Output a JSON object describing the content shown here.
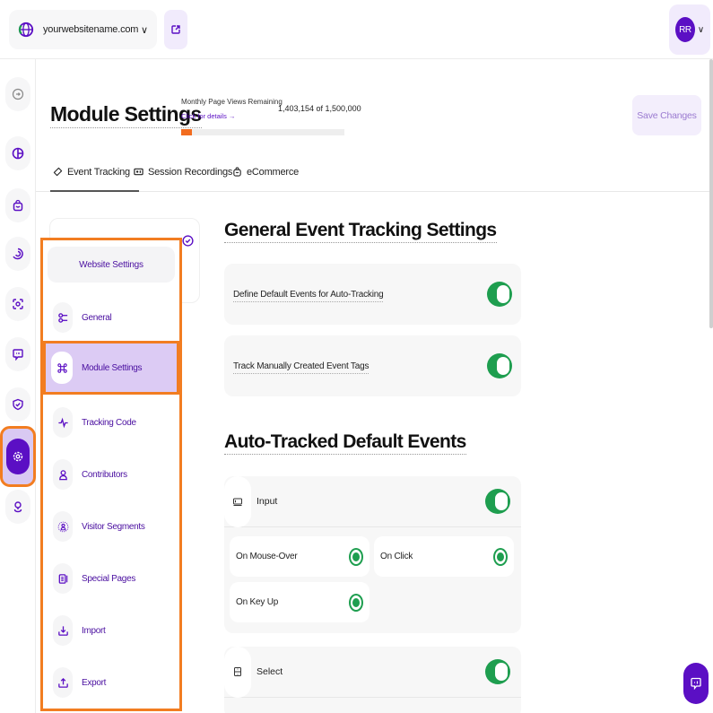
{
  "topbar": {
    "site_name": "yourwebsitename.com",
    "site_icon": "globe-icon",
    "external_link_icon": "external-link-icon",
    "user_initials": "RR"
  },
  "rail": {
    "items": [
      {
        "name": "collapse",
        "icon": "arrow-right-circle-icon"
      },
      {
        "name": "analytics",
        "icon": "pie-chart-icon"
      },
      {
        "name": "ecommerce",
        "icon": "shopping-bag-icon"
      },
      {
        "name": "heatmaps",
        "icon": "target-icon"
      },
      {
        "name": "recordings",
        "icon": "scan-icon"
      },
      {
        "name": "feedback",
        "icon": "chat-icon"
      },
      {
        "name": "privacy",
        "icon": "shield-check-icon"
      },
      {
        "name": "settings",
        "icon": "gear-icon",
        "active": true
      },
      {
        "name": "locations",
        "icon": "map-pin-icon"
      }
    ]
  },
  "header": {
    "title": "Module Settings",
    "page_views_label": "Monthly Page Views Remaining",
    "page_views_link": "Click for details →",
    "page_views_value": "1,403,154 of 1,500,000",
    "page_views_used_fraction": 0.065,
    "save_label": "Save Changes"
  },
  "tabs": [
    {
      "label": "Event Tracking",
      "icon": "tag-icon",
      "active": true
    },
    {
      "label": "Session Recordings",
      "icon": "recording-icon",
      "active": false
    },
    {
      "label": "eCommerce",
      "icon": "shopping-bag-icon",
      "active": false
    }
  ],
  "settings_menu": {
    "header": "Website Settings",
    "items": [
      {
        "label": "General",
        "icon": "toggles-icon"
      },
      {
        "label": "Module Settings",
        "icon": "command-icon",
        "active": true
      },
      {
        "label": "Tracking Code",
        "icon": "pulse-icon"
      },
      {
        "label": "Contributors",
        "icon": "user-icon"
      },
      {
        "label": "Visitor Segments",
        "icon": "user-segment-icon"
      },
      {
        "label": "Special Pages",
        "icon": "document-icon"
      },
      {
        "label": "Import",
        "icon": "download-icon"
      },
      {
        "label": "Export",
        "icon": "upload-icon"
      }
    ]
  },
  "general_section": {
    "title": "General Event Tracking Settings",
    "settings": [
      {
        "label": "Define Default Events for Auto-Tracking",
        "enabled": true
      },
      {
        "label": "Track Manually Created Event Tags",
        "enabled": true
      }
    ]
  },
  "auto_section": {
    "title": "Auto-Tracked Default Events",
    "groups": [
      {
        "name": "Input",
        "icon": "input-field-icon",
        "enabled": true,
        "options": [
          {
            "label": "On Mouse-Over",
            "selected": true
          },
          {
            "label": "On Click",
            "selected": true
          },
          {
            "label": "On Key Up",
            "selected": true
          }
        ]
      },
      {
        "name": "Select",
        "icon": "select-field-icon",
        "enabled": true
      }
    ]
  },
  "colors": {
    "brand": "#5b0fc4",
    "highlight": "#f27d21",
    "toggle_on": "#1e9e4f",
    "progress": "#f26c1f"
  }
}
